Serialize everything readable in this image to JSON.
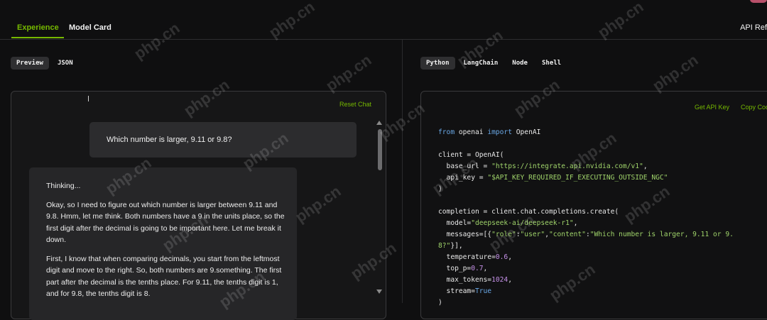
{
  "header": {
    "tabs": [
      {
        "label": "Experience",
        "active": true
      },
      {
        "label": "Model Card",
        "active": false
      }
    ],
    "api_ref_label": "API Ref"
  },
  "left": {
    "view_tabs": [
      {
        "label": "Preview",
        "active": true
      },
      {
        "label": "JSON",
        "active": false
      }
    ],
    "reset_chat_label": "Reset Chat",
    "user_message": "Which number is larger, 9.11 or 9.8?",
    "assistant": {
      "thinking_label": "Thinking...",
      "paragraphs": [
        "Okay, so I need to figure out which number is larger between 9.11 and 9.8. Hmm, let me think. Both numbers have a 9 in the units place, so the first digit after the decimal is going to be important here. Let me break it down.",
        "First, I know that when comparing decimals, you start from the leftmost digit and move to the right. So, both numbers are 9.something. The first part after the decimal is the tenths place. For 9.11, the tenths digit is 1, and for 9.8, the tenths digit is 8."
      ]
    }
  },
  "right": {
    "lang_tabs": [
      {
        "label": "Python",
        "active": true
      },
      {
        "label": "LangChain",
        "active": false
      },
      {
        "label": "Node",
        "active": false
      },
      {
        "label": "Shell",
        "active": false
      }
    ],
    "get_api_key_label": "Get API Key",
    "copy_code_label": "Copy Code",
    "code_lines": [
      [
        {
          "t": "kw",
          "v": "from"
        },
        {
          "t": "p",
          "v": " openai "
        },
        {
          "t": "kw",
          "v": "import"
        },
        {
          "t": "p",
          "v": " OpenAI"
        }
      ],
      [],
      [
        {
          "t": "p",
          "v": "client = OpenAI("
        }
      ],
      [
        {
          "t": "p",
          "v": "  base_url = "
        },
        {
          "t": "str",
          "v": "\"https://integrate.api.nvidia.com/v1\""
        },
        {
          "t": "p",
          "v": ","
        }
      ],
      [
        {
          "t": "p",
          "v": "  api_key = "
        },
        {
          "t": "str",
          "v": "\"$API_KEY_REQUIRED_IF_EXECUTING_OUTSIDE_NGC\""
        }
      ],
      [
        {
          "t": "p",
          "v": ")"
        }
      ],
      [],
      [
        {
          "t": "p",
          "v": "completion = client.chat.completions.create("
        }
      ],
      [
        {
          "t": "p",
          "v": "  model="
        },
        {
          "t": "str",
          "v": "\"deepseek-ai/deepseek-r1\""
        },
        {
          "t": "p",
          "v": ","
        }
      ],
      [
        {
          "t": "p",
          "v": "  messages=[{"
        },
        {
          "t": "str",
          "v": "\"role\""
        },
        {
          "t": "p",
          "v": ":"
        },
        {
          "t": "str",
          "v": "\"user\""
        },
        {
          "t": "p",
          "v": ","
        },
        {
          "t": "str",
          "v": "\"content\""
        },
        {
          "t": "p",
          "v": ":"
        },
        {
          "t": "str",
          "v": "\"Which number is larger, 9.11 or 9."
        }
      ],
      [
        {
          "t": "str",
          "v": "8?\""
        },
        {
          "t": "p",
          "v": "}],"
        }
      ],
      [
        {
          "t": "p",
          "v": "  temperature="
        },
        {
          "t": "num",
          "v": "0.6"
        },
        {
          "t": "p",
          "v": ","
        }
      ],
      [
        {
          "t": "p",
          "v": "  top_p="
        },
        {
          "t": "num",
          "v": "0.7"
        },
        {
          "t": "p",
          "v": ","
        }
      ],
      [
        {
          "t": "p",
          "v": "  max_tokens="
        },
        {
          "t": "num",
          "v": "1024"
        },
        {
          "t": "p",
          "v": ","
        }
      ],
      [
        {
          "t": "p",
          "v": "  stream="
        },
        {
          "t": "bool",
          "v": "True"
        }
      ],
      [
        {
          "t": "p",
          "v": ")"
        }
      ]
    ]
  },
  "watermark_text": "php.cn",
  "colors": {
    "accent": "#76b900",
    "background": "#0f0f10"
  }
}
